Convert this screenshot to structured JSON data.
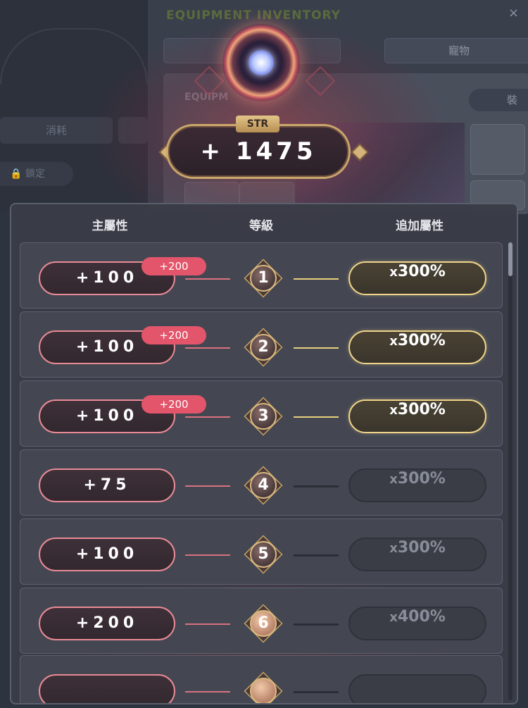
{
  "background": {
    "window_title": "EQUIPMENT INVENTORY",
    "close_glyph": "×",
    "tab_right": "寵物",
    "subtitle": "EQUIPM",
    "equip_button": "裝",
    "left_tab": "消耗",
    "lock_label": "🔒 鎖定"
  },
  "header": {
    "stat_tag": "STR",
    "stat_total": "+ 1475"
  },
  "columns": {
    "main_stat": "主屬性",
    "level": "等級",
    "bonus_stat": "追加屬性"
  },
  "rows": [
    {
      "main": "+100",
      "bonus_badge": "+200",
      "level": "1",
      "additional_x": "x",
      "additional": "300%",
      "active": true
    },
    {
      "main": "+100",
      "bonus_badge": "+200",
      "level": "2",
      "additional_x": "x",
      "additional": "300%",
      "active": true
    },
    {
      "main": "+100",
      "bonus_badge": "+200",
      "level": "3",
      "additional_x": "x",
      "additional": "300%",
      "active": true
    },
    {
      "main": "+75",
      "bonus_badge": null,
      "level": "4",
      "additional_x": "x",
      "additional": "300%",
      "active": false
    },
    {
      "main": "+100",
      "bonus_badge": null,
      "level": "5",
      "additional_x": "x",
      "additional": "300%",
      "active": false
    },
    {
      "main": "+200",
      "bonus_badge": null,
      "level": "6",
      "additional_x": "x",
      "additional": "400%",
      "active": false
    }
  ],
  "colors": {
    "main_border": "#e98b96",
    "bonus_badge": "#e2556a",
    "active_gold": "#efd489",
    "panel_bg": "#3a3c46"
  }
}
